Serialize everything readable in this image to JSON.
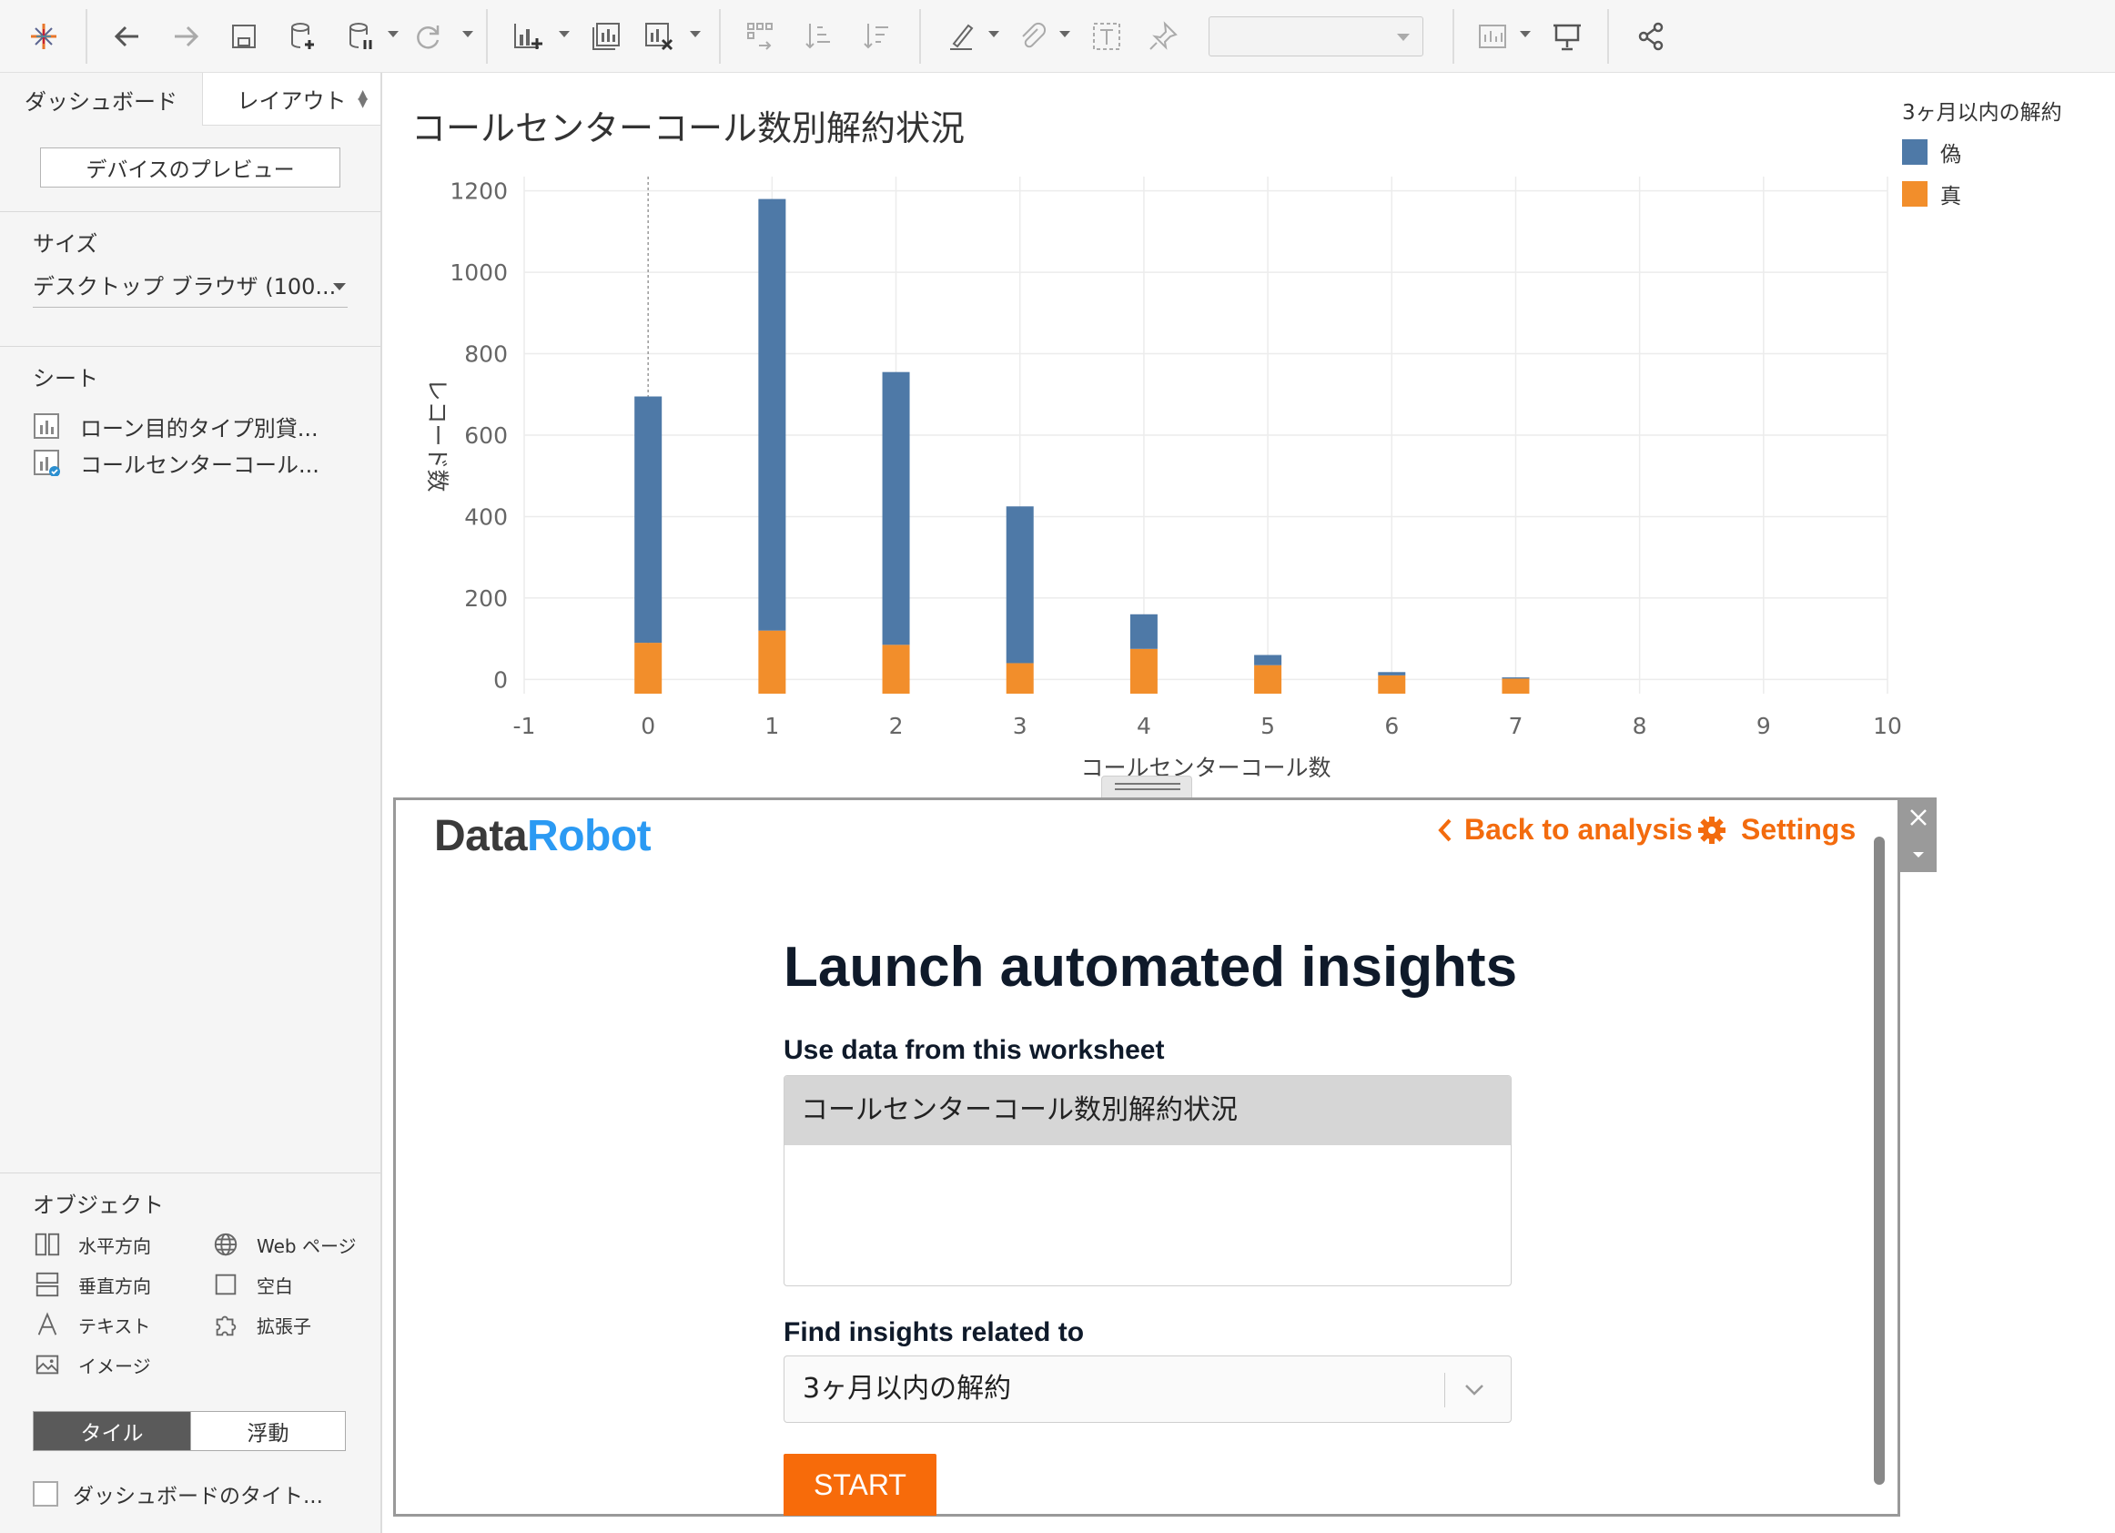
{
  "panel": {
    "tabs": [
      "ダッシュボード",
      "レイアウト"
    ],
    "device_preview_label": "デバイスのプレビュー",
    "size_heading": "サイズ",
    "size_value": "デスクトップ ブラウザ (100...",
    "sheets_heading": "シート",
    "sheets": [
      "ローン目的タイプ別貸...",
      "コールセンターコール..."
    ],
    "objects_heading": "オブジェクト",
    "objects": [
      {
        "label": "水平方向",
        "icon": "horizontal-container-icon"
      },
      {
        "label": "Web ページ",
        "icon": "globe-icon"
      },
      {
        "label": "垂直方向",
        "icon": "vertical-container-icon"
      },
      {
        "label": "空白",
        "icon": "blank-square-icon"
      },
      {
        "label": "テキスト",
        "icon": "text-a-icon"
      },
      {
        "label": "拡張子",
        "icon": "puzzle-piece-icon"
      },
      {
        "label": "イメージ",
        "icon": "image-icon"
      }
    ],
    "tile_label": "タイル",
    "float_label": "浮動",
    "show_title_label": "ダッシュボードのタイト..."
  },
  "chart_data": {
    "type": "bar",
    "stacked": true,
    "title": "コールセンターコール数別解約状況",
    "xlabel": "コールセンターコール数",
    "ylabel": "レコード数",
    "x_ticks": [
      -1,
      0,
      1,
      2,
      3,
      4,
      5,
      6,
      7,
      8,
      9,
      10
    ],
    "y_ticks": [
      0,
      200,
      400,
      600,
      800,
      1000,
      1200
    ],
    "xlim": [
      -1,
      10
    ],
    "ylim": [
      -35,
      1235
    ],
    "categories": [
      0,
      1,
      2,
      3,
      4,
      5,
      6,
      7
    ],
    "legend_title": "3ヶ月以内の解約",
    "legend_position": "top-right",
    "series": [
      {
        "name": "偽",
        "color": "#4e79a7",
        "values": [
          605,
          1060,
          670,
          385,
          85,
          25,
          8,
          3
        ]
      },
      {
        "name": "真",
        "color": "#f28e2b",
        "values": [
          90,
          120,
          85,
          40,
          75,
          35,
          10,
          2
        ]
      }
    ],
    "grid": true
  },
  "extension": {
    "logo_dark": "Data",
    "logo_blue": "Robot",
    "back_label": "Back to analysis",
    "settings_label": "Settings",
    "heading": "Launch automated insights",
    "worksheet_label": "Use data from this worksheet",
    "worksheet_selected": "コールセンターコール数別解約状況",
    "insights_label": "Find insights related to",
    "target_value": "3ヶ月以内の解約",
    "start_label": "START",
    "accent_color": "#f36b0e",
    "logo_blue_color": "#2b9af3"
  }
}
